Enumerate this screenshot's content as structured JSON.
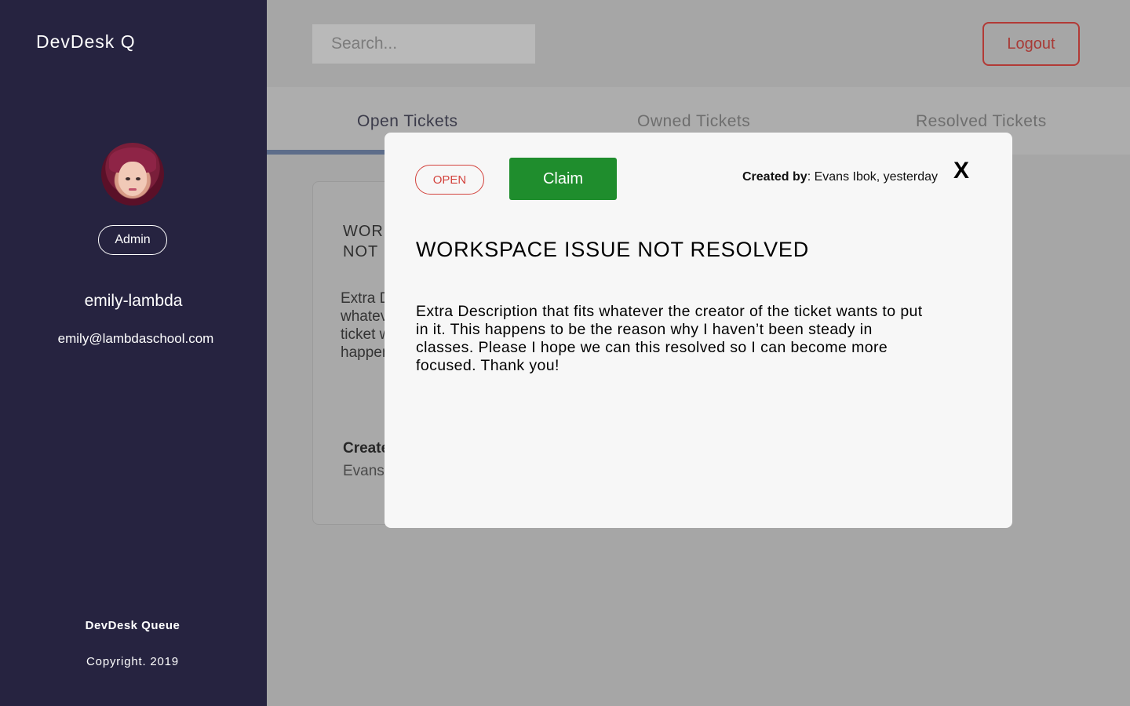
{
  "sidebar": {
    "brand": "DevDesk Q",
    "role": "Admin",
    "username": "emily-lambda",
    "email": "emily@lambdaschool.com",
    "footer_name": "DevDesk Queue",
    "footer_copyright": "Copyright. 2019"
  },
  "header": {
    "search_placeholder": "Search...",
    "logout_label": "Logout"
  },
  "tabs": [
    {
      "label": "Open Tickets",
      "active": true
    },
    {
      "label": "Owned Tickets",
      "active": false
    },
    {
      "label": "Resolved Tickets",
      "active": false
    }
  ],
  "background_card": {
    "title": "WORKSPACE ISSUE NOT RESOLVED",
    "description": "Extra Description that fits whatever the creator of the ticket wants to put in it. This happens",
    "created_label": "Created by:",
    "created_value": "Evans Ibok, yesterday"
  },
  "modal": {
    "status": "OPEN",
    "claim_label": "Claim",
    "created_by_label": "Created by",
    "created_by_value": ": Evans Ibok, yesterday",
    "close_label": "X",
    "title": "WORKSPACE ISSUE NOT RESOLVED",
    "description": "Extra Description that fits whatever the creator of the ticket wants to put in it. This happens to be the reason why I haven’t been steady in classes. Please I hope we can this resolved so I can become more focused. Thank you!"
  },
  "colors": {
    "sidebar_bg": "#262340",
    "overlay_bg": "#a6a6a6",
    "claim_green": "#1f8d2d",
    "open_red": "#d3433d",
    "logout_red": "#b23a36",
    "tab_indicator": "#5d6d8a"
  }
}
